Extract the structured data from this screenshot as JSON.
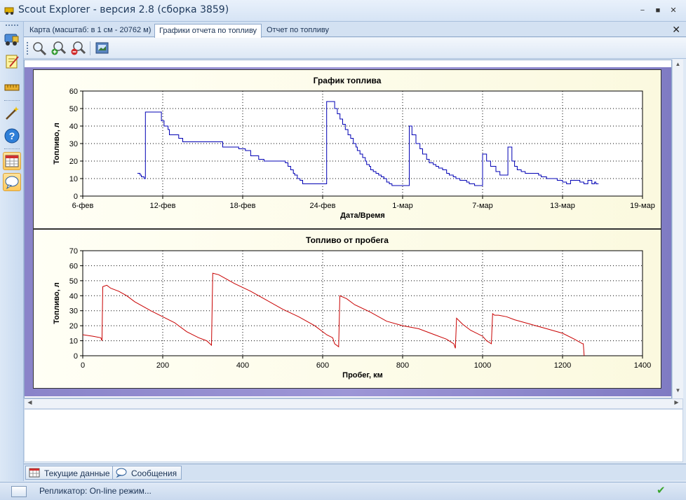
{
  "window": {
    "title": "Scout Explorer - версия 2.8 (сборка 3859)",
    "minimize_icon": "minimize-icon",
    "maximize_icon": "maximize-icon",
    "close_icon": "close-icon"
  },
  "tabs": [
    {
      "label": "Карта (масштаб: в 1 см - 20762 м)",
      "active": false
    },
    {
      "label": "Графики отчета по топливу",
      "active": true
    },
    {
      "label": "Отчет по топливу",
      "active": false
    }
  ],
  "toolbar": {
    "buttons": [
      "zoom-icon",
      "zoom-in-icon",
      "zoom-out-icon",
      "save-image-icon"
    ]
  },
  "sidebar": {
    "items": [
      "vehicle-icon",
      "notepad-icon",
      "ruler-icon",
      "magic-wand-icon",
      "help-icon",
      "calendar-icon",
      "message-icon"
    ]
  },
  "charts": [
    {
      "title": "График топлива",
      "xlabel": "Дата/Время",
      "ylabel": "Топливо, л"
    },
    {
      "title": "Топливо от пробега",
      "xlabel": "Пробег, км",
      "ylabel": "Топливо, л"
    }
  ],
  "chart_data": [
    {
      "type": "line",
      "title": "График топлива",
      "xlabel": "Дата/Время",
      "ylabel": "Топливо, л",
      "x_tick_labels": [
        "6-фев",
        "12-фев",
        "18-фев",
        "24-фев",
        "1-мар",
        "7-мар",
        "13-мар",
        "19-мар"
      ],
      "x_tick_days": [
        0,
        6,
        12,
        18,
        24,
        30,
        36,
        42
      ],
      "xlim_days": [
        0,
        42
      ],
      "ylim": [
        0,
        60
      ],
      "y_ticks": [
        0,
        10,
        20,
        30,
        40,
        50,
        60
      ],
      "grid": true,
      "color": "#0000b4",
      "series": [
        {
          "x_days": [
            4.1,
            4.3,
            4.4,
            4.6,
            4.7,
            5.9,
            6.1,
            6.4,
            6.5,
            7.2,
            7.5,
            10.2,
            10.5,
            11.5,
            11.7,
            12.2,
            12.6,
            13.2,
            13.6,
            15.2,
            15.4,
            15.6,
            15.8,
            15.9,
            16.1,
            16.3,
            16.5,
            18.0,
            18.3,
            18.5,
            18.7,
            18.9,
            19.1,
            19.3,
            19.5,
            19.7,
            19.9,
            20.1,
            20.3,
            20.5,
            20.6,
            20.8,
            21.0,
            21.2,
            21.3,
            21.5,
            21.6,
            21.8,
            22.0,
            22.2,
            22.4,
            22.6,
            22.8,
            23.0,
            23.2,
            23.4,
            24.5,
            24.7,
            25.0,
            25.3,
            25.5,
            25.8,
            26.0,
            26.3,
            26.5,
            26.7,
            27.0,
            27.3,
            27.5,
            27.8,
            28.0,
            28.3,
            28.5,
            28.8,
            29.0,
            29.2,
            29.4,
            29.6,
            29.8,
            30.0,
            30.3,
            30.6,
            31.0,
            31.3,
            31.6,
            31.9,
            32.2,
            32.4,
            32.6,
            32.9,
            33.2,
            33.5,
            33.8,
            34.0,
            34.2,
            34.4,
            34.6,
            34.8,
            35.2,
            35.6,
            36.0,
            36.3,
            36.6,
            37.0,
            37.3,
            37.6,
            37.9,
            38.2,
            38.4,
            38.5,
            38.6,
            38.7
          ],
          "y": [
            13,
            12,
            11,
            10,
            48,
            43,
            40,
            38,
            35,
            33,
            31,
            31,
            28,
            28,
            27,
            26,
            23,
            21,
            20,
            19,
            17,
            15,
            13,
            12,
            10,
            9,
            7,
            7,
            54,
            54,
            54,
            50,
            47,
            44,
            41,
            38,
            35,
            33,
            30,
            28,
            26,
            24,
            22,
            20,
            18,
            17,
            15,
            14,
            13,
            12,
            11,
            10,
            8,
            7,
            6,
            6,
            40,
            35,
            30,
            27,
            24,
            21,
            19,
            18,
            17,
            16,
            15,
            13,
            12,
            11,
            10,
            9,
            9,
            8,
            7,
            7,
            6,
            6,
            6,
            24,
            20,
            17,
            14,
            12,
            12,
            28,
            20,
            17,
            15,
            14,
            13,
            13,
            13,
            13,
            12,
            11,
            11,
            10,
            10,
            9,
            8,
            7,
            9,
            9,
            8,
            7,
            9,
            7,
            8,
            7,
            7,
            7
          ]
        }
      ]
    },
    {
      "type": "line",
      "title": "Топливо от пробега",
      "xlabel": "Пробег, км",
      "ylabel": "Топливо, л",
      "x_ticks": [
        0,
        200,
        400,
        600,
        800,
        1000,
        1200,
        1400
      ],
      "xlim": [
        0,
        1400
      ],
      "ylim": [
        0,
        70
      ],
      "y_ticks": [
        0,
        10,
        20,
        30,
        40,
        50,
        60,
        70
      ],
      "grid": true,
      "color": "#c80000",
      "series": [
        {
          "x": [
            0,
            25,
            45,
            48,
            50,
            60,
            70,
            90,
            110,
            130,
            150,
            170,
            200,
            230,
            260,
            290,
            310,
            318,
            322,
            325,
            340,
            360,
            380,
            420,
            460,
            500,
            540,
            580,
            610,
            625,
            630,
            640,
            643,
            660,
            680,
            720,
            760,
            800,
            840,
            880,
            910,
            928,
            932,
            935,
            950,
            970,
            1000,
            1010,
            1022,
            1025,
            1030,
            1040,
            1060,
            1080,
            1120,
            1160,
            1200,
            1230,
            1250,
            1252,
            1254
          ],
          "y": [
            14,
            13,
            12,
            10,
            46,
            47,
            45,
            43,
            40,
            36,
            33,
            30,
            26,
            22,
            16,
            12,
            10,
            8,
            7,
            55,
            54,
            51,
            48,
            43,
            37,
            31,
            26,
            20,
            14,
            12,
            8,
            6,
            40,
            38,
            34,
            29,
            23,
            20,
            18,
            14,
            11,
            8,
            5,
            25,
            21,
            17,
            13,
            10,
            8,
            28,
            27,
            27,
            26,
            24,
            21,
            18,
            15,
            11,
            8,
            8,
            0
          ]
        }
      ]
    }
  ],
  "bottom_tabs": [
    {
      "label": "Текущие данные",
      "icon": "calendar-icon"
    },
    {
      "label": "Сообщения",
      "icon": "message-icon"
    }
  ],
  "status": {
    "text": "Репликатор: On-line режим...",
    "check_icon": "check-icon"
  }
}
